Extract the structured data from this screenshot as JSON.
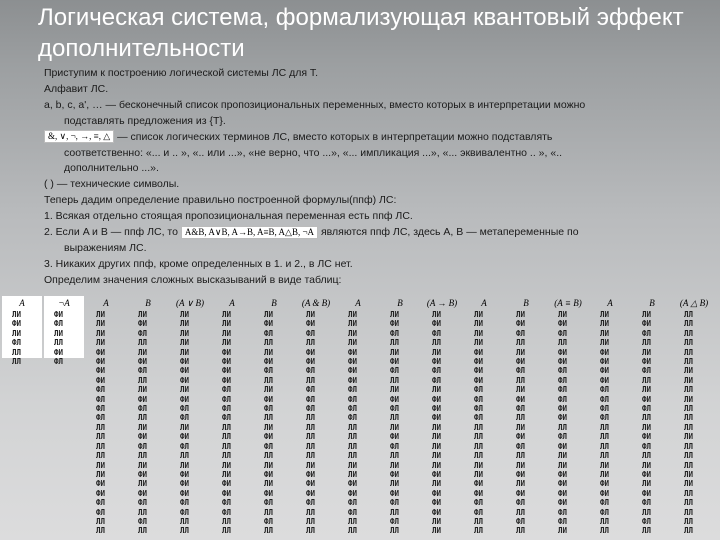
{
  "slide": {
    "title": "Логическая система, формализующая квантовый эффект дополнительности"
  },
  "body": {
    "l1": "Приступим к построению логической системы ЛС для Т.",
    "l2": "Алфавит ЛС.",
    "l3a": "a, b, c, a', … — бесконечный список пропозициональных переменных, вместо которых в интерпретации можно",
    "l3b": "подставлять предложения из {Т}.",
    "l4_symbols": "&, ∨, ¬, →, ≡, △",
    "l4a": "— список логических терминов ЛС, вместо которых в интерпретации можно подставлять",
    "l4b": "соответственно: «... и .. », «.. или ...», «не верно, что ...», «... импликация ...», «... эквивалентно .. », «..",
    "l4c": "дополнительно ...».",
    "l5": "( ) — технические символы.",
    "l6": "Теперь дадим определение правильно построенной формулы(ппф) ЛС:",
    "l7": "1. Всякая отдельно стоящая пропозициональная переменная есть ппф ЛС.",
    "l8_pre": "2. Если A и B — ппф ЛС, то",
    "l8_formula": "A&B, A∨B, A→B, A≡B, A△B, ¬A",
    "l8_post": "являются ппф ЛС, здесь A, B — метапеременные по",
    "l8b": "выражениям ЛС.",
    "l9": "3. Никаких других ппф, кроме определенных в 1. и 2., в ЛС нет.",
    "l10": "Определим значения сложных высказываний в виде таблиц:"
  },
  "tables": {
    "columns": [
      {
        "header": "A",
        "cells": [
          "ЛИ",
          "ФИ",
          "ЛИ",
          "ФЛ",
          "ЛЛ",
          "ЛЛ"
        ]
      },
      {
        "header": "¬A",
        "cells": [
          "ФИ",
          "ФЛ",
          "ЛИ",
          "ЛЛ",
          "ФИ",
          "ФЛ"
        ]
      },
      {
        "header": "A",
        "cells": [
          "ЛИ",
          "ЛИ",
          "ЛИ",
          "ЛИ",
          "ФИ",
          "ФИ",
          "ФИ",
          "ФИ",
          "ФЛ",
          "ФЛ",
          "ФЛ",
          "ФЛ",
          "ЛЛ",
          "ЛЛ",
          "ЛЛ",
          "ЛЛ",
          "ЛИ",
          "ЛИ",
          "ФИ",
          "ФИ",
          "ФЛ",
          "ФЛ",
          "ЛЛ",
          "ЛЛ"
        ]
      },
      {
        "header": "B",
        "cells": [
          "ЛИ",
          "ФИ",
          "ФЛ",
          "ЛЛ",
          "ЛИ",
          "ФИ",
          "ФЛ",
          "ЛЛ",
          "ЛИ",
          "ФИ",
          "ФЛ",
          "ЛЛ",
          "ЛИ",
          "ФИ",
          "ФЛ",
          "ЛЛ",
          "ЛИ",
          "ФИ",
          "ЛИ",
          "ФИ",
          "ФЛ",
          "ЛЛ",
          "ФЛ",
          "ЛЛ"
        ]
      },
      {
        "header": "(A ∨ B)",
        "cells": [
          "ЛИ",
          "ЛИ",
          "ЛИ",
          "ЛИ",
          "ЛИ",
          "ФИ",
          "ФИ",
          "ФИ",
          "ЛИ",
          "ФИ",
          "ФЛ",
          "ФЛ",
          "ЛИ",
          "ФИ",
          "ФЛ",
          "ЛЛ",
          "ЛИ",
          "ФИ",
          "ФИ",
          "ФИ",
          "ФЛ",
          "ФЛ",
          "ЛЛ",
          "ЛЛ"
        ]
      },
      {
        "header": "A",
        "cells": [
          "ЛИ",
          "ЛИ",
          "ЛИ",
          "ЛИ",
          "ФИ",
          "ФИ",
          "ФИ",
          "ФИ",
          "ФЛ",
          "ФЛ",
          "ФЛ",
          "ФЛ",
          "ЛЛ",
          "ЛЛ",
          "ЛЛ",
          "ЛЛ",
          "ЛИ",
          "ЛИ",
          "ФИ",
          "ФИ",
          "ФЛ",
          "ФЛ",
          "ЛЛ",
          "ЛЛ"
        ]
      },
      {
        "header": "B",
        "cells": [
          "ЛИ",
          "ФИ",
          "ФЛ",
          "ЛЛ",
          "ЛИ",
          "ФИ",
          "ФЛ",
          "ЛЛ",
          "ЛИ",
          "ФИ",
          "ФЛ",
          "ЛЛ",
          "ЛИ",
          "ФИ",
          "ФЛ",
          "ЛЛ",
          "ЛИ",
          "ФИ",
          "ЛИ",
          "ФИ",
          "ФЛ",
          "ЛЛ",
          "ФЛ",
          "ЛЛ"
        ]
      },
      {
        "header": "(A & B)",
        "cells": [
          "ЛИ",
          "ФИ",
          "ФЛ",
          "ЛЛ",
          "ФИ",
          "ФИ",
          "ФЛ",
          "ЛЛ",
          "ФЛ",
          "ФЛ",
          "ФЛ",
          "ЛЛ",
          "ЛЛ",
          "ЛЛ",
          "ЛЛ",
          "ЛЛ",
          "ЛИ",
          "ФИ",
          "ФИ",
          "ФИ",
          "ФЛ",
          "ЛЛ",
          "ЛЛ",
          "ЛЛ"
        ]
      },
      {
        "header": "A",
        "cells": [
          "ЛИ",
          "ЛИ",
          "ЛИ",
          "ЛИ",
          "ФИ",
          "ФИ",
          "ФИ",
          "ФИ",
          "ФЛ",
          "ФЛ",
          "ФЛ",
          "ФЛ",
          "ЛЛ",
          "ЛЛ",
          "ЛЛ",
          "ЛЛ",
          "ЛИ",
          "ЛИ",
          "ФИ",
          "ФИ",
          "ФЛ",
          "ФЛ",
          "ЛЛ",
          "ЛЛ"
        ]
      },
      {
        "header": "B",
        "cells": [
          "ЛИ",
          "ФИ",
          "ФЛ",
          "ЛЛ",
          "ЛИ",
          "ФИ",
          "ФЛ",
          "ЛЛ",
          "ЛИ",
          "ФИ",
          "ФЛ",
          "ЛЛ",
          "ЛИ",
          "ФИ",
          "ФЛ",
          "ЛЛ",
          "ЛИ",
          "ФИ",
          "ЛИ",
          "ФИ",
          "ФЛ",
          "ЛЛ",
          "ФЛ",
          "ЛЛ"
        ]
      },
      {
        "header": "(A → B)",
        "cells": [
          "ЛИ",
          "ФИ",
          "ФЛ",
          "ЛЛ",
          "ЛИ",
          "ФИ",
          "ФЛ",
          "ФЛ",
          "ЛИ",
          "ФИ",
          "ФИ",
          "ФИ",
          "ЛИ",
          "ЛИ",
          "ЛИ",
          "ЛИ",
          "ЛИ",
          "ФИ",
          "ЛИ",
          "ФИ",
          "ФИ",
          "ФИ",
          "ЛИ",
          "ЛИ"
        ]
      },
      {
        "header": "A",
        "cells": [
          "ЛИ",
          "ЛИ",
          "ЛИ",
          "ЛИ",
          "ФИ",
          "ФИ",
          "ФИ",
          "ФИ",
          "ФЛ",
          "ФЛ",
          "ФЛ",
          "ФЛ",
          "ЛЛ",
          "ЛЛ",
          "ЛЛ",
          "ЛЛ",
          "ЛИ",
          "ЛИ",
          "ФИ",
          "ФИ",
          "ФЛ",
          "ФЛ",
          "ЛЛ",
          "ЛЛ"
        ]
      },
      {
        "header": "B",
        "cells": [
          "ЛИ",
          "ФИ",
          "ФЛ",
          "ЛЛ",
          "ЛИ",
          "ФИ",
          "ФЛ",
          "ЛЛ",
          "ЛИ",
          "ФИ",
          "ФЛ",
          "ЛЛ",
          "ЛИ",
          "ФИ",
          "ФЛ",
          "ЛЛ",
          "ЛИ",
          "ФИ",
          "ЛИ",
          "ФИ",
          "ФЛ",
          "ЛЛ",
          "ФЛ",
          "ЛЛ"
        ]
      },
      {
        "header": "(A ≡ B)",
        "cells": [
          "ЛИ",
          "ФИ",
          "ФЛ",
          "ЛЛ",
          "ФИ",
          "ФИ",
          "ФЛ",
          "ФЛ",
          "ФЛ",
          "ФЛ",
          "ФИ",
          "ФИ",
          "ЛЛ",
          "ФЛ",
          "ФИ",
          "ЛИ",
          "ЛИ",
          "ФИ",
          "ФИ",
          "ФИ",
          "ФИ",
          "ФЛ",
          "ФЛ",
          "ЛИ"
        ]
      },
      {
        "header": "A",
        "cells": [
          "ЛИ",
          "ЛИ",
          "ЛИ",
          "ЛИ",
          "ФИ",
          "ФИ",
          "ФИ",
          "ФИ",
          "ФЛ",
          "ФЛ",
          "ФЛ",
          "ФЛ",
          "ЛЛ",
          "ЛЛ",
          "ЛЛ",
          "ЛЛ",
          "ЛИ",
          "ЛИ",
          "ФИ",
          "ФИ",
          "ФЛ",
          "ФЛ",
          "ЛЛ",
          "ЛЛ"
        ]
      },
      {
        "header": "B",
        "cells": [
          "ЛИ",
          "ФИ",
          "ФЛ",
          "ЛЛ",
          "ЛИ",
          "ФИ",
          "ФЛ",
          "ЛЛ",
          "ЛИ",
          "ФИ",
          "ФЛ",
          "ЛЛ",
          "ЛИ",
          "ФИ",
          "ФЛ",
          "ЛЛ",
          "ЛИ",
          "ФИ",
          "ЛИ",
          "ФИ",
          "ФЛ",
          "ЛЛ",
          "ФЛ",
          "ЛЛ"
        ]
      },
      {
        "header": "(A △ B)",
        "cells": [
          "ЛЛ",
          "ЛЛ",
          "ЛЛ",
          "ЛЛ",
          "ЛЛ",
          "ЛЛ",
          "ЛИ",
          "ЛИ",
          "ЛЛ",
          "ЛИ",
          "ЛЛ",
          "ЛЛ",
          "ЛЛ",
          "ЛИ",
          "ЛЛ",
          "ЛЛ",
          "ЛЛ",
          "ЛИ",
          "ЛИ",
          "ЛЛ",
          "ЛЛ",
          "ЛЛ",
          "ЛЛ",
          "ЛЛ"
        ]
      }
    ]
  }
}
